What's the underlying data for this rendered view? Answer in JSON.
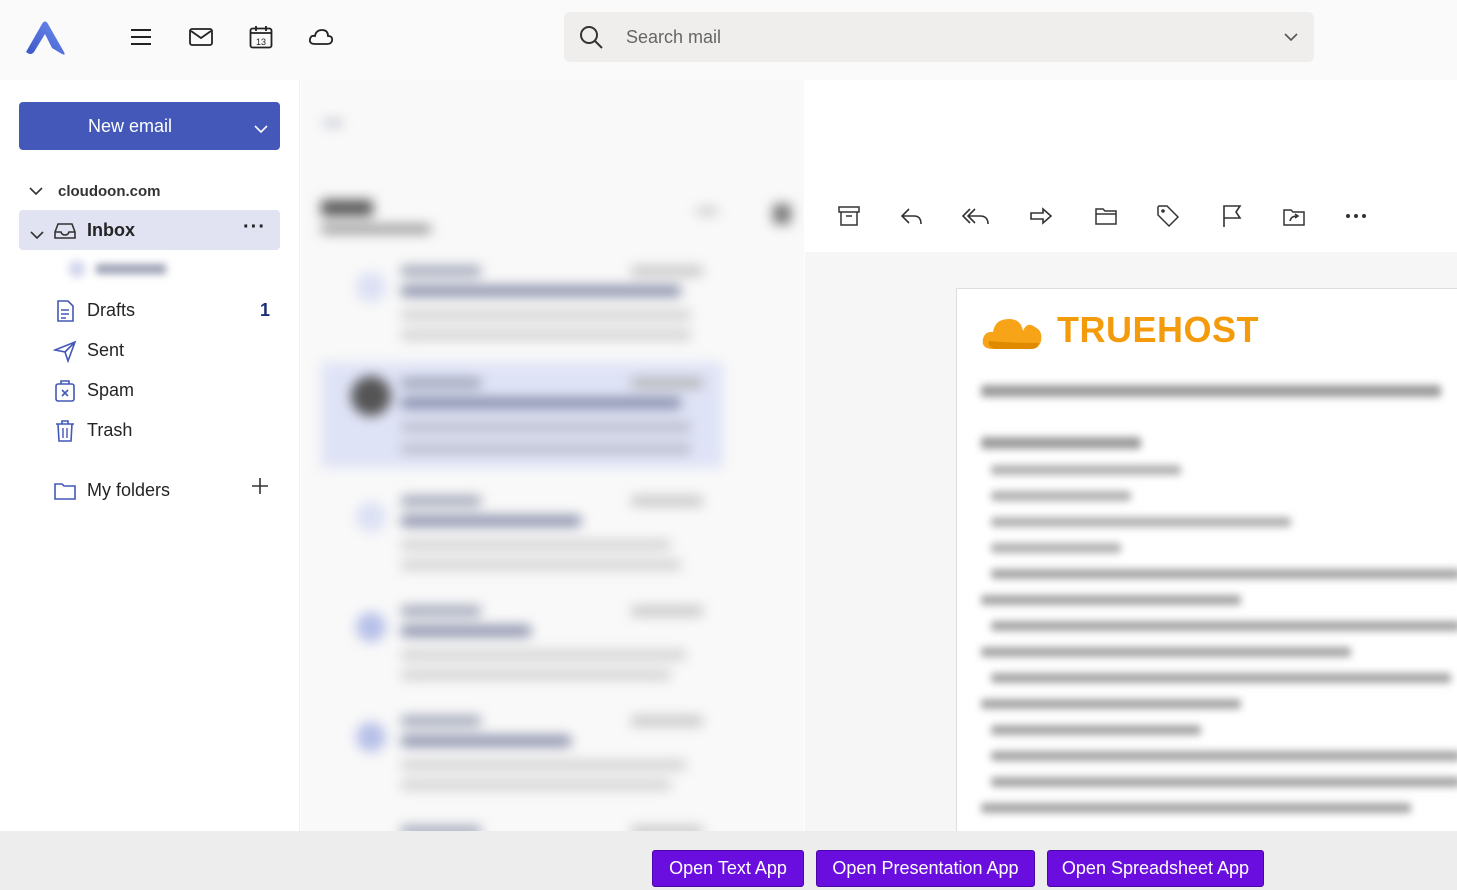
{
  "search": {
    "placeholder": "Search mail"
  },
  "sidebar": {
    "new_email_label": "New email",
    "account": "cloudoon.com",
    "folders": [
      {
        "label": "Inbox",
        "count": ""
      },
      {
        "label": "Drafts",
        "count": "1"
      },
      {
        "label": "Sent",
        "count": ""
      },
      {
        "label": "Spam",
        "count": ""
      },
      {
        "label": "Trash",
        "count": ""
      }
    ],
    "my_folders_label": "My folders"
  },
  "toolbar": {
    "icons": [
      "archive-icon",
      "reply-icon",
      "reply-all-icon",
      "forward-icon",
      "move-to-folder-icon",
      "tag-icon",
      "flag-icon",
      "share-icon",
      "more-icon"
    ]
  },
  "reading": {
    "brand_name": "TRUEHOST"
  },
  "calendar_day": "13",
  "bottom": {
    "text_app": "Open Text App",
    "presentation_app": "Open Presentation App",
    "spreadsheet_app": "Open Spreadsheet App"
  },
  "colors": {
    "accent": "#4358b8",
    "brand": "#f39b0b",
    "app_button": "#6a0ddf"
  }
}
